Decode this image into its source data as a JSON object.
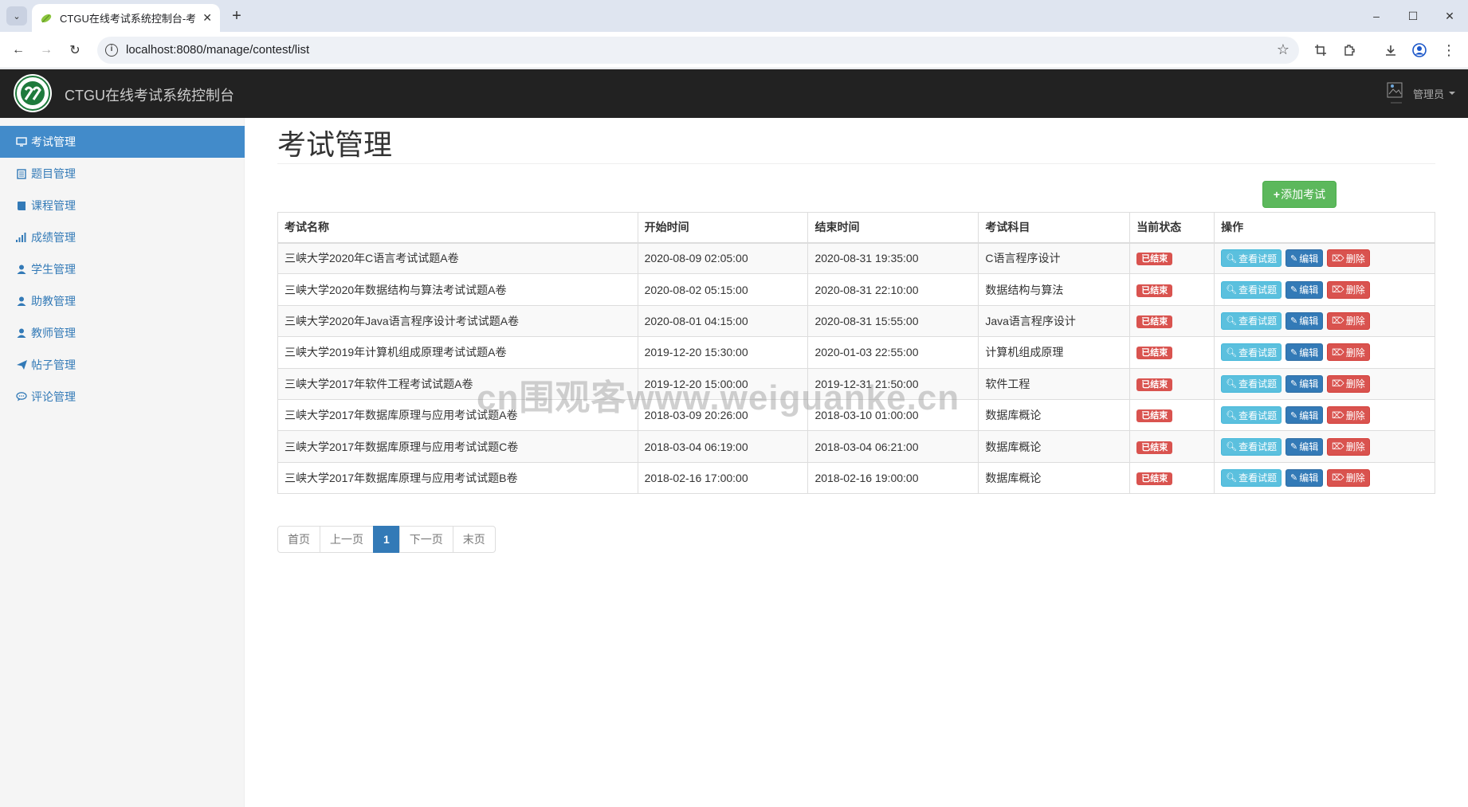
{
  "browser": {
    "tab_title": "CTGU在线考试系统控制台-考试",
    "url": "localhost:8080/manage/contest/list"
  },
  "navbar": {
    "brand_title": "CTGU在线考试系统控制台",
    "user_name": "管理员"
  },
  "sidebar": {
    "items": [
      {
        "label": "考试管理",
        "icon": "monitor-icon",
        "active": true
      },
      {
        "label": "题目管理",
        "icon": "list-icon",
        "active": false
      },
      {
        "label": "课程管理",
        "icon": "book-icon",
        "active": false
      },
      {
        "label": "成绩管理",
        "icon": "signal-icon",
        "active": false
      },
      {
        "label": "学生管理",
        "icon": "user-icon",
        "active": false
      },
      {
        "label": "助教管理",
        "icon": "user-icon",
        "active": false
      },
      {
        "label": "教师管理",
        "icon": "user-icon",
        "active": false
      },
      {
        "label": "帖子管理",
        "icon": "send-icon",
        "active": false
      },
      {
        "label": "评论管理",
        "icon": "comment-icon",
        "active": false
      }
    ]
  },
  "main": {
    "title": "考试管理",
    "add_button": "添加考试",
    "columns": [
      "考试名称",
      "开始时间",
      "结束时间",
      "考试科目",
      "当前状态",
      "操作"
    ],
    "rows": [
      {
        "name": "三峡大学2020年C语言考试试题A卷",
        "start": "2020-08-09 02:05:00",
        "end": "2020-08-31 19:35:00",
        "subject": "C语言程序设计",
        "status": "已结束"
      },
      {
        "name": "三峡大学2020年数据结构与算法考试试题A卷",
        "start": "2020-08-02 05:15:00",
        "end": "2020-08-31 22:10:00",
        "subject": "数据结构与算法",
        "status": "已结束"
      },
      {
        "name": "三峡大学2020年Java语言程序设计考试试题A卷",
        "start": "2020-08-01 04:15:00",
        "end": "2020-08-31 15:55:00",
        "subject": "Java语言程序设计",
        "status": "已结束"
      },
      {
        "name": "三峡大学2019年计算机组成原理考试试题A卷",
        "start": "2019-12-20 15:30:00",
        "end": "2020-01-03 22:55:00",
        "subject": "计算机组成原理",
        "status": "已结束"
      },
      {
        "name": "三峡大学2017年软件工程考试试题A卷",
        "start": "2019-12-20 15:00:00",
        "end": "2019-12-31 21:50:00",
        "subject": "软件工程",
        "status": "已结束"
      },
      {
        "name": "三峡大学2017年数据库原理与应用考试试题A卷",
        "start": "2018-03-09 20:26:00",
        "end": "2018-03-10 01:00:00",
        "subject": "数据库概论",
        "status": "已结束"
      },
      {
        "name": "三峡大学2017年数据库原理与应用考试试题C卷",
        "start": "2018-03-04 06:19:00",
        "end": "2018-03-04 06:21:00",
        "subject": "数据库概论",
        "status": "已结束"
      },
      {
        "name": "三峡大学2017年数据库原理与应用考试试题B卷",
        "start": "2018-02-16 17:00:00",
        "end": "2018-02-16 19:00:00",
        "subject": "数据库概论",
        "status": "已结束"
      }
    ],
    "row_actions": {
      "view": "查看试题",
      "edit": "编辑",
      "delete": "删除"
    },
    "pagination": {
      "first": "首页",
      "prev": "上一页",
      "current": "1",
      "next": "下一页",
      "last": "末页"
    }
  },
  "watermark": "cn围观客www.weiguanke.cn",
  "colors": {
    "navbar": "#222222",
    "active_item": "#428bca",
    "add_button": "#5cb85c",
    "info": "#5bc0de",
    "primary": "#337ab7",
    "danger": "#d9534f"
  }
}
